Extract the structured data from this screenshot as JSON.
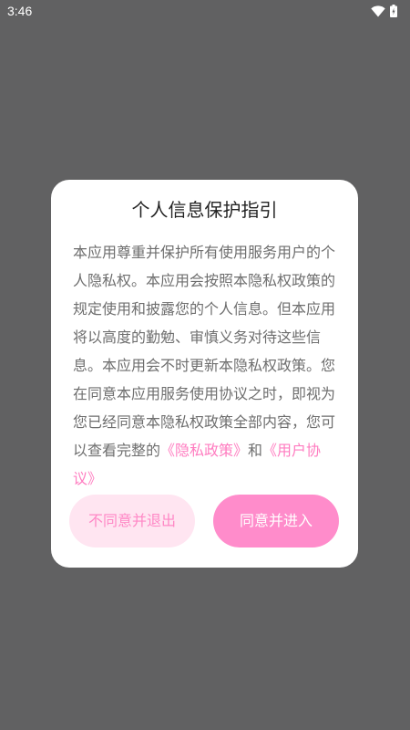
{
  "status_bar": {
    "time": "3:46",
    "icons": [
      "wifi-icon",
      "battery-icon"
    ]
  },
  "dialog": {
    "title": "个人信息保护指引",
    "body_text": "本应用尊重并保护所有使用服务用户的个人隐私权。本应用会按照本隐私权政策的规定使用和披露您的个人信息。但本应用将以高度的勤勉、审慎义务对待这些信息。本应用会不时更新本隐私权政策。您在同意本应用服务使用协议之时，即视为您已经同意本隐私权政策全部内容，您可以查看完整的",
    "privacy_link": "《隐私政策》",
    "conjunction": "和",
    "agreement_link": "《用户协议》",
    "disagree_button": "不同意并退出",
    "agree_button": "同意并进入"
  },
  "colors": {
    "backdrop": "#616162",
    "accent": "#ff8ccb",
    "accent_light": "#ffe5f1",
    "link": "#ff7cc0"
  }
}
